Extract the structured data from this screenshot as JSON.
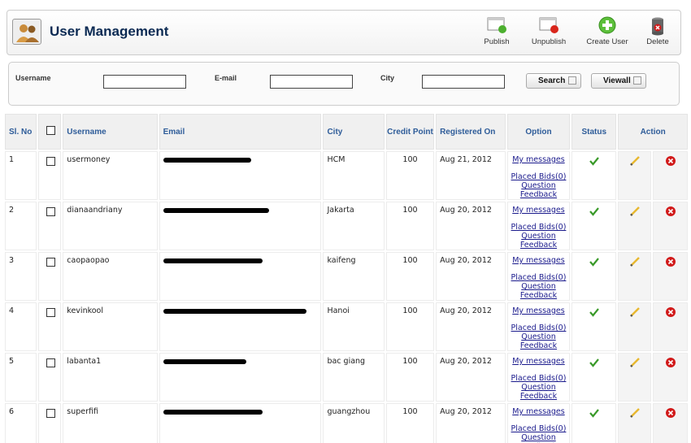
{
  "header": {
    "title": "User Management",
    "toolbar": {
      "publish": "Publish",
      "unpublish": "Unpublish",
      "create_user": "Create User",
      "delete": "Delete"
    }
  },
  "filter": {
    "username_label": "Username",
    "email_label": "E-mail",
    "city_label": "City",
    "username_value": "",
    "email_value": "",
    "city_value": "",
    "search_label": "Search",
    "viewall_label": "Viewall"
  },
  "table": {
    "columns": {
      "sl_no": "Sl. No",
      "username": "Username",
      "email": "Email",
      "city": "City",
      "credit_point": "Credit Point",
      "registered_on": "Registered On",
      "option": "Option",
      "status": "Status",
      "action": "Action"
    },
    "option_links": {
      "messages": "My messages",
      "placed_bids": "Placed Bids(0)",
      "question": "Question",
      "feedback": "Feedback"
    },
    "rows": [
      {
        "sl": "1",
        "username": "usermoney",
        "city": "HCM",
        "credit": "100",
        "registered": "Aug 21, 2012",
        "status": "published"
      },
      {
        "sl": "2",
        "username": "dianaandriany",
        "city": "Jakarta",
        "credit": "100",
        "registered": "Aug 20, 2012",
        "status": "published"
      },
      {
        "sl": "3",
        "username": "caopaopao",
        "city": "kaifeng",
        "credit": "100",
        "registered": "Aug 20, 2012",
        "status": "published"
      },
      {
        "sl": "4",
        "username": "kevinkool",
        "city": "Hanoi",
        "credit": "100",
        "registered": "Aug 20, 2012",
        "status": "published"
      },
      {
        "sl": "5",
        "username": "labanta1",
        "city": "bac giang",
        "credit": "100",
        "registered": "Aug 20, 2012",
        "status": "published"
      },
      {
        "sl": "6",
        "username": "superfifi",
        "city": "guangzhou",
        "credit": "100",
        "registered": "Aug 20, 2012",
        "status": "published"
      }
    ]
  },
  "icons": {
    "header": "users-icon",
    "publish": "publish-icon",
    "unpublish": "unpublish-icon",
    "create_user": "add-icon",
    "delete": "trash-icon",
    "status": "checkmark-icon",
    "edit": "pencil-icon",
    "remove": "delete-icon"
  },
  "colors": {
    "title": "#0b2a53",
    "header_text": "#2e5c99",
    "credit": "#8b0000",
    "link": "#1a1a8c",
    "check": "#3a9a2a",
    "remove": "#d11a1a"
  }
}
